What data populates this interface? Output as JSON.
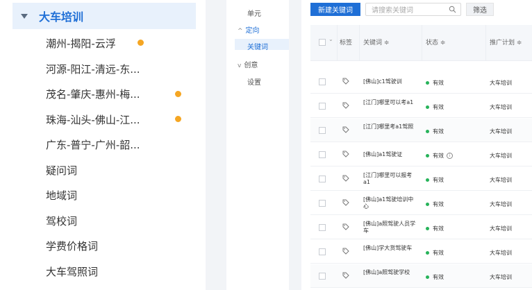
{
  "tree": {
    "root_label": "大车培训",
    "items": [
      {
        "label": "潮州-揭阳-云浮",
        "dot": true
      },
      {
        "label": "河源-阳江-清远-东...",
        "dot": false
      },
      {
        "label": "茂名-肇庆-惠州-梅...",
        "dot": true
      },
      {
        "label": "珠海-汕头-佛山-江...",
        "dot": true
      },
      {
        "label": "广东-普宁-广州-韶...",
        "dot": false
      },
      {
        "label": "疑问词",
        "dot": false
      },
      {
        "label": "地域词",
        "dot": false
      },
      {
        "label": "驾校词",
        "dot": false
      },
      {
        "label": "学费价格词",
        "dot": false
      },
      {
        "label": "大车驾照词",
        "dot": false
      }
    ]
  },
  "midnav": {
    "items": [
      {
        "label": "单元",
        "caret": "",
        "active": false
      },
      {
        "label": "定向",
        "caret": "^",
        "active": true
      },
      {
        "label": "关键词",
        "caret": "",
        "active": true
      },
      {
        "label": "创意",
        "caret": "v",
        "active": false
      },
      {
        "label": "设置",
        "caret": "",
        "active": false
      }
    ]
  },
  "toolbar": {
    "new_button": "新建关键词",
    "search_placeholder": "请搜索关键词",
    "filter_button": "筛选"
  },
  "table": {
    "headers": {
      "tag": "标签",
      "keyword": "关键词 ≑",
      "status": "状态 ≑",
      "plan": "推广计划 ≑"
    },
    "rows": [
      {
        "keyword": "[佛山]c1驾驶训",
        "status": "有效",
        "info": false,
        "plan": "大车培训"
      },
      {
        "keyword": "[江门]哪里可以考a1",
        "status": "有效",
        "info": false,
        "plan": "大车培训"
      },
      {
        "keyword": "[江门]哪里考a1驾照",
        "status": "有效",
        "info": false,
        "plan": "大车培训"
      },
      {
        "keyword": "[佛山]a1驾驶证",
        "status": "有效",
        "info": true,
        "plan": "大车培训"
      },
      {
        "keyword": "[江门]哪里可以报考a1",
        "status": "有效",
        "info": false,
        "plan": "大车培训"
      },
      {
        "keyword": "[佛山]a1驾驶培训中心",
        "status": "有效",
        "info": false,
        "plan": "大车培训"
      },
      {
        "keyword": "[佛山]a照驾驶人员学车",
        "status": "有效",
        "info": false,
        "plan": "大车培训"
      },
      {
        "keyword": "[佛山]学大货驾驶车",
        "status": "有效",
        "info": false,
        "plan": "大车培训"
      },
      {
        "keyword": "[佛山]a照驾驶学校",
        "status": "有效",
        "info": false,
        "plan": "大车培训"
      }
    ]
  },
  "colors": {
    "accent": "#1f6fd6",
    "dot_orange": "#f5a623",
    "status_green": "#27b35a"
  }
}
